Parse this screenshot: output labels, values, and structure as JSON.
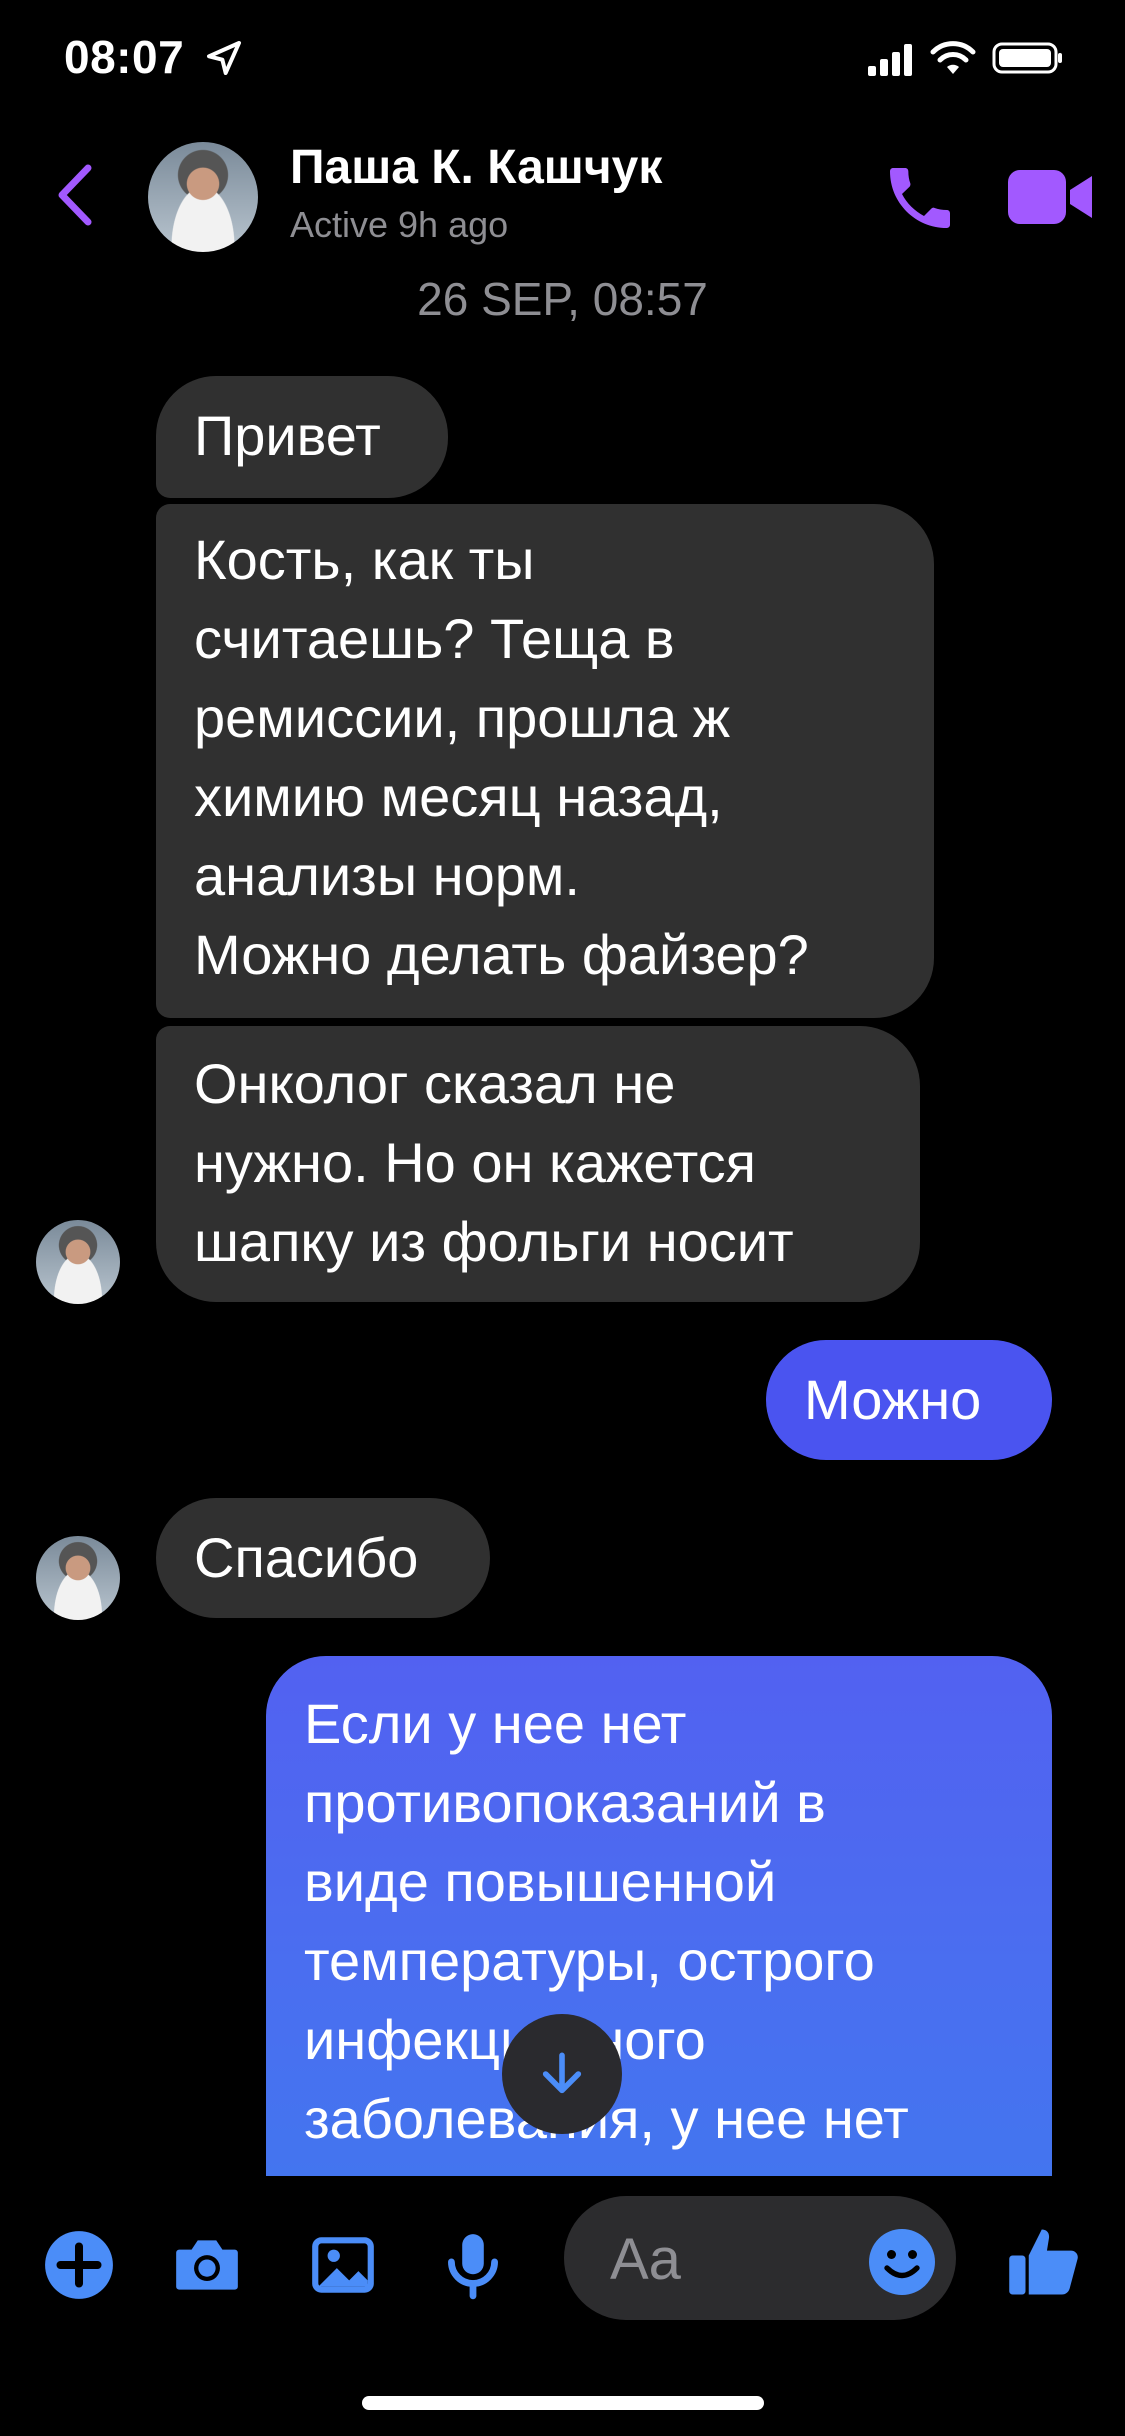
{
  "status_bar": {
    "time": "08:07"
  },
  "header": {
    "contact_name": "Паша К. Кашчук",
    "contact_status": "Active 9h ago",
    "back_icon": "chevron-left-icon",
    "call_icon": "phone-icon",
    "video_icon": "video-camera-icon"
  },
  "timestamp": "26 SEP, 08:57",
  "messages": [
    {
      "side": "incoming",
      "text": "Привет"
    },
    {
      "side": "incoming",
      "text": "Кость, как ты\nсчитаешь? Теща в\nремиссии, прошла ж\nхимию месяц назад,\nанализы норм.\nМожно делать файзер?"
    },
    {
      "side": "incoming",
      "text": "Онколог сказал не\nнужно. Но он кажется\nшапку из фольги носит"
    },
    {
      "side": "outgoing",
      "text": "Можно"
    },
    {
      "side": "incoming",
      "text": "Спасибо"
    },
    {
      "side": "outgoing",
      "text": "Если у нее нет\nпротивопоказаний в\nвиде повышенной\nтемпературы, острого\nинфекционного\nзаболевания, у нее нет"
    }
  ],
  "composer": {
    "placeholder": "Aa",
    "icons": [
      "plus-icon",
      "camera-icon",
      "gallery-icon",
      "microphone-icon",
      "emoji-icon",
      "thumbs-up-icon"
    ]
  },
  "colors": {
    "accent": "#a259ff",
    "composer_blue": "#4b8df8",
    "incoming_bubble": "#303030",
    "outgoing_bubble": "#4a54f0"
  }
}
